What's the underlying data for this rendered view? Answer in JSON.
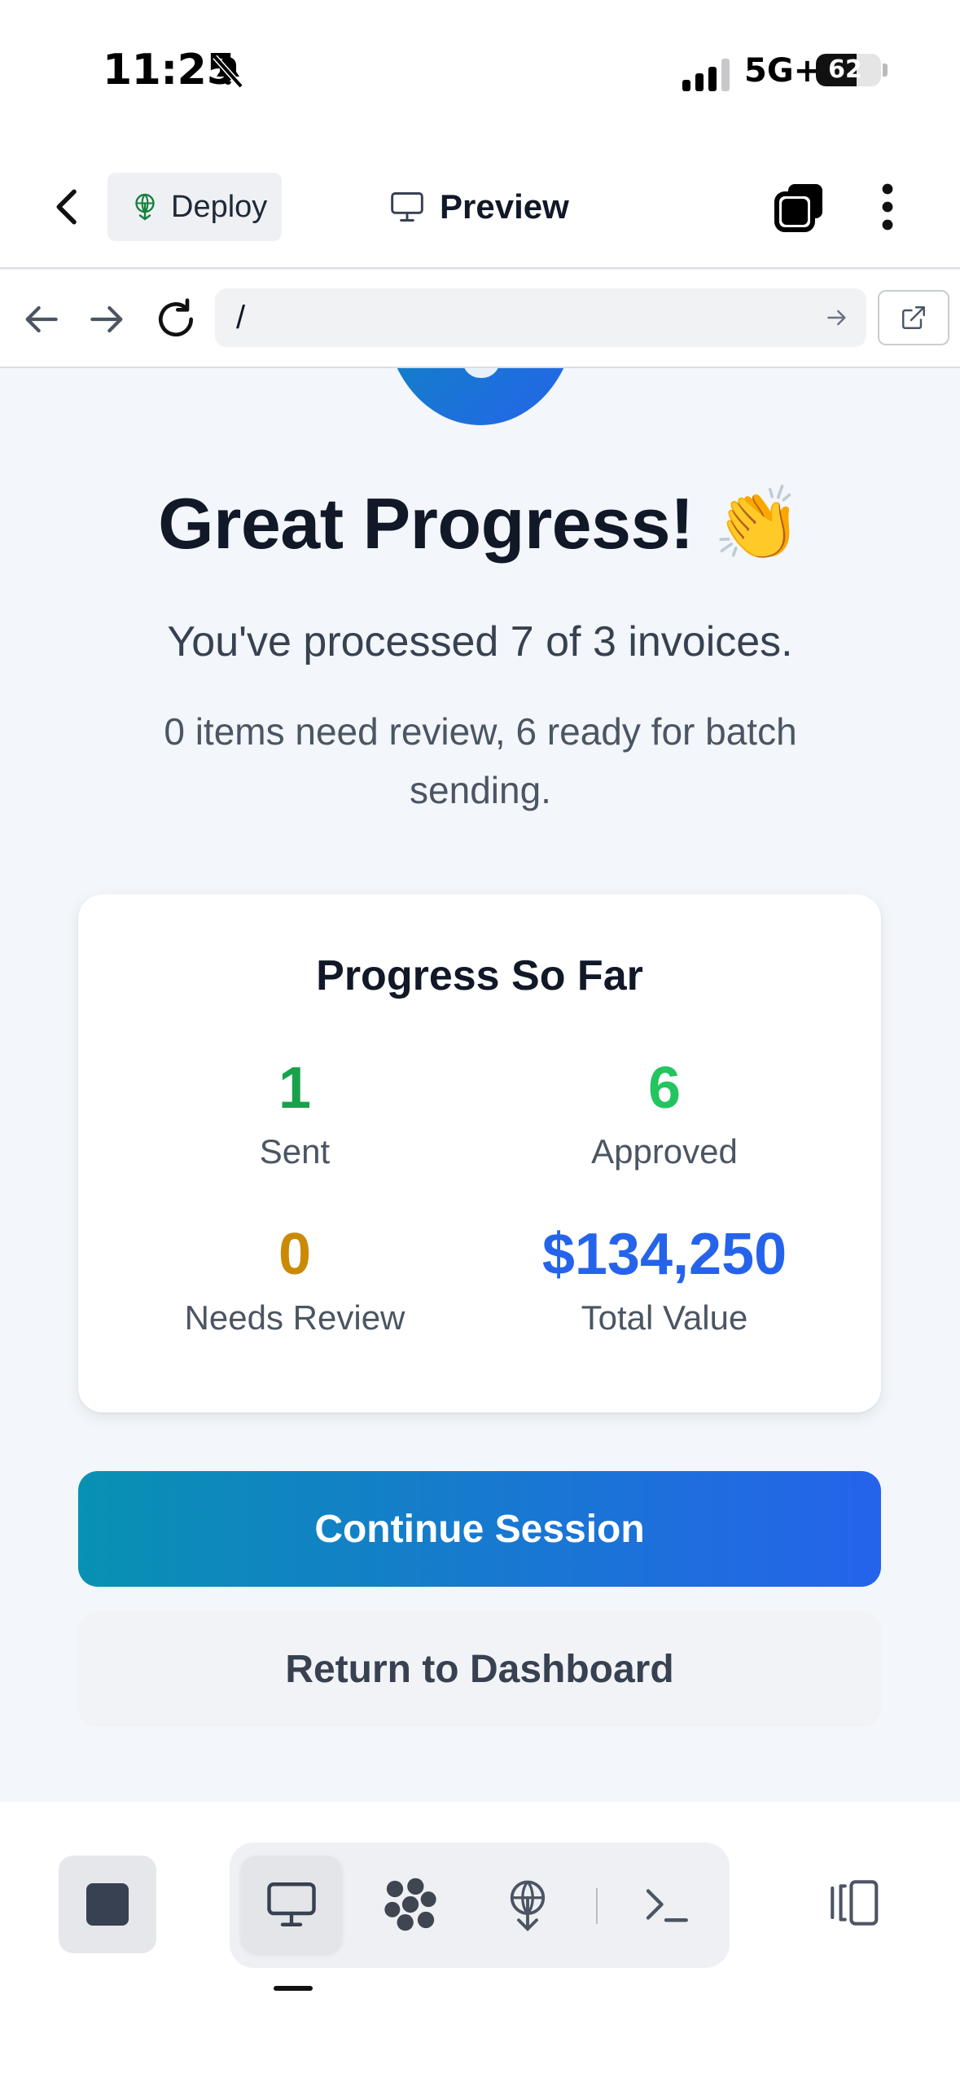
{
  "status_bar": {
    "time": "11:25",
    "network": "5G+",
    "battery": "62",
    "battery_level": 0.62
  },
  "header": {
    "deploy_label": "Deploy",
    "preview_label": "Preview"
  },
  "browser": {
    "url": "/"
  },
  "hero": {
    "headline": "Great Progress! 👏",
    "subline": "You've processed 7 of 3 invoices.",
    "subline2": "0 items need review, 6 ready for batch sending."
  },
  "card": {
    "title": "Progress So Far",
    "stats": [
      {
        "value": "1",
        "label": "Sent",
        "color": "#16a34a"
      },
      {
        "value": "6",
        "label": "Approved",
        "color": "#22c55e"
      },
      {
        "value": "0",
        "label": "Needs Review",
        "color": "#ca8a04"
      },
      {
        "value": "$134,250",
        "label": "Total Value",
        "color": "#2563eb"
      }
    ]
  },
  "actions": {
    "primary": "Continue Session",
    "secondary": "Return to Dashboard"
  },
  "colors": {
    "accent_start": "#0891b2",
    "accent_end": "#2563eb"
  },
  "icons": {
    "bell": "bell-slash-icon",
    "back": "chevron-left-icon",
    "deploy": "deploy-antenna-icon",
    "preview": "monitor-icon",
    "tabs": "tabs-icon",
    "more": "more-vertical-icon",
    "nav_back": "arrow-left-icon",
    "nav_forward": "arrow-right-icon",
    "reload": "reload-icon",
    "open_external": "external-link-icon",
    "stop": "stop-icon",
    "console": "terminal-icon",
    "layout": "layout-toggle-icon"
  }
}
